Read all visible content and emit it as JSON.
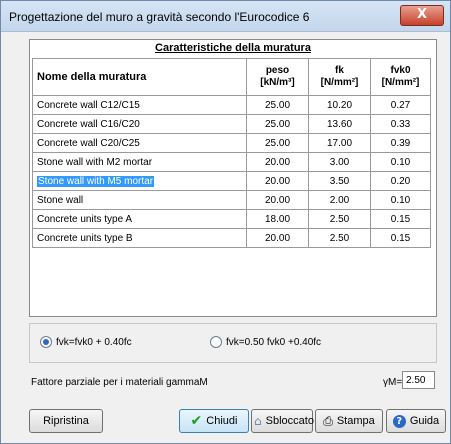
{
  "window": {
    "title": "Progettazione del muro a gravità secondo l'Eurocodice 6",
    "close_label": "X"
  },
  "panel": {
    "title": "Caratteristiche della muratura"
  },
  "table": {
    "headers": {
      "name": "Nome della muratura",
      "peso": "peso",
      "peso_unit": "[kN/m³]",
      "fk": "fk",
      "fk_unit": "[N/mm²]",
      "fvk0": "fvk0",
      "fvk0_unit": "[N/mm²]"
    },
    "rows": [
      {
        "name": "Concrete wall C12/C15",
        "peso": "25.00",
        "fk": "10.20",
        "fvk0": "0.27"
      },
      {
        "name": "Concrete wall C16/C20",
        "peso": "25.00",
        "fk": "13.60",
        "fvk0": "0.33"
      },
      {
        "name": "Concrete wall C20/C25",
        "peso": "25.00",
        "fk": "17.00",
        "fvk0": "0.39"
      },
      {
        "name": "Stone wall with M2 mortar",
        "peso": "20.00",
        "fk": "3.00",
        "fvk0": "0.10"
      },
      {
        "name": "Stone wall with M5 mortar",
        "peso": "20.00",
        "fk": "3.50",
        "fvk0": "0.20"
      },
      {
        "name": "Stone wall",
        "peso": "20.00",
        "fk": "2.00",
        "fvk0": "0.10"
      },
      {
        "name": "Concrete units type A",
        "peso": "18.00",
        "fk": "2.50",
        "fvk0": "0.15"
      },
      {
        "name": "Concrete units type B",
        "peso": "20.00",
        "fk": "2.50",
        "fvk0": "0.15"
      }
    ],
    "selected_row": 4
  },
  "options": {
    "radio1": "fvk=fvk0 + 0.40fc",
    "radio2": "fvk=0.50 fvk0 +0.40fc",
    "selected": 1
  },
  "gamma": {
    "label": "Fattore parziale per i materiali gammaM",
    "symbol": "γM=",
    "value": "2.50"
  },
  "buttons": {
    "reset": "Ripristina",
    "close": "Chiudi",
    "unlock": "Sbloccato",
    "print": "Stampa",
    "help": "Guida"
  },
  "colors": {
    "selection": "#3399ff",
    "close_button": "#c7412b"
  }
}
